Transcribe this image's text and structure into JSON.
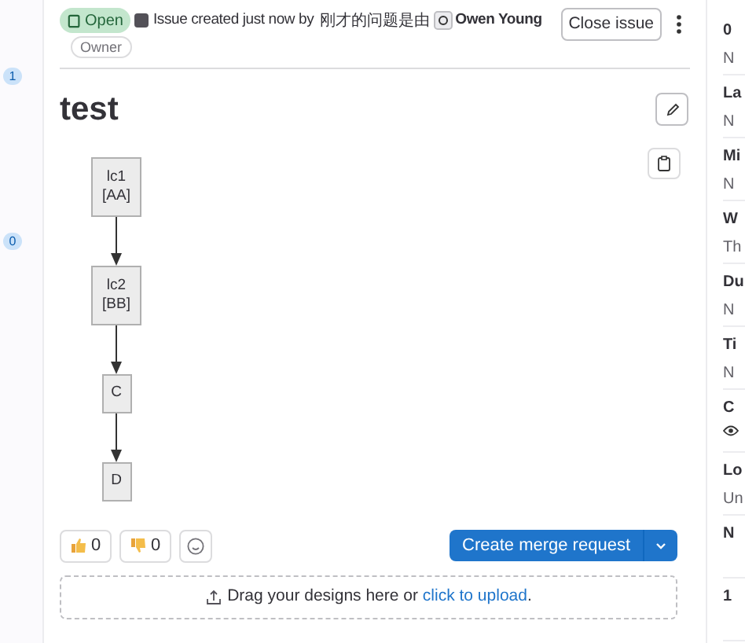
{
  "gutter": {
    "badges": [
      "1",
      "0"
    ]
  },
  "header": {
    "status": "Open",
    "created": "Issue created just now by",
    "chinese": "刚才的问题是由",
    "author": "Owen Young",
    "role": "Owner",
    "close_button": "Close issue"
  },
  "title": "test",
  "diagram": {
    "nodes": [
      {
        "lines": [
          "lc1",
          "[AA]"
        ]
      },
      {
        "lines": [
          "lc2",
          "[BB]"
        ]
      },
      {
        "lines": [
          "C"
        ]
      },
      {
        "lines": [
          "D"
        ]
      }
    ]
  },
  "reactions": [
    {
      "kind": "thumbsup",
      "count": "0"
    },
    {
      "kind": "thumbsdown",
      "count": "0"
    }
  ],
  "merge_button": "Create merge request",
  "dropzone": {
    "text": "Drag your designs here or",
    "link": "click to upload",
    "end": "."
  },
  "sidebar": [
    {
      "title": "0",
      "value": "N"
    },
    {
      "title": "La",
      "value": "N"
    },
    {
      "title": "Mi",
      "value": "N"
    },
    {
      "title": "W",
      "value": "Th"
    },
    {
      "title": "Du",
      "value": "N"
    },
    {
      "title": "Ti",
      "value": "N"
    },
    {
      "title": "C",
      "kind": "eye"
    },
    {
      "title": "Lo",
      "value": "Un"
    },
    {
      "title": "N"
    },
    {
      "title": "1"
    }
  ]
}
